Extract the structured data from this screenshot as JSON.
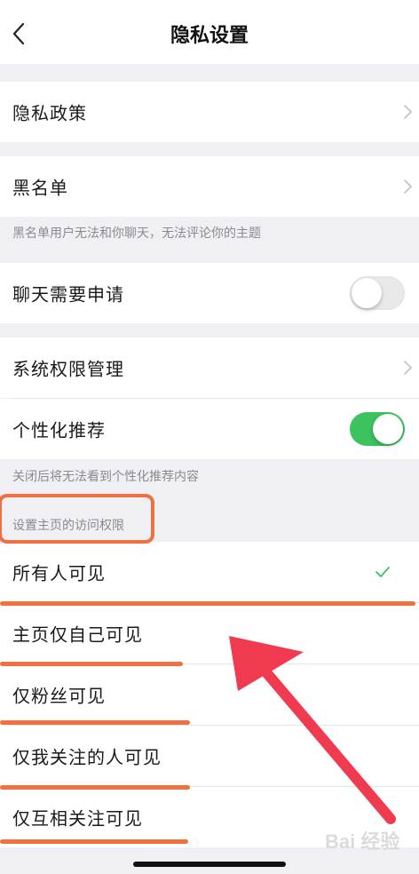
{
  "header": {
    "title": "隐私设置",
    "back_icon": "chevron-left-icon"
  },
  "rows": {
    "privacy_policy": "隐私政策",
    "blacklist": "黑名单",
    "blacklist_note": "黑名单用户无法和你聊天，无法评论你的主题",
    "chat_request": "聊天需要申请",
    "chat_request_on": false,
    "system_permissions": "系统权限管理",
    "personalized": "个性化推荐",
    "personalized_on": true,
    "personalized_note": "关闭后将无法看到个性化推荐内容"
  },
  "visibility": {
    "section_title": "设置主页的访问权限",
    "options": [
      {
        "label": "所有人可见",
        "selected": true
      },
      {
        "label": "主页仅自己可见",
        "selected": false
      },
      {
        "label": "仅粉丝可见",
        "selected": false
      },
      {
        "label": "仅我关注的人可见",
        "selected": false
      },
      {
        "label": "仅互相关注可见",
        "selected": false
      }
    ]
  },
  "colors": {
    "accent_green": "#3cc25f",
    "annotation_orange": "#f0703f",
    "arrow_red": "#f03a4f"
  },
  "watermark_text": "Bai 经验"
}
